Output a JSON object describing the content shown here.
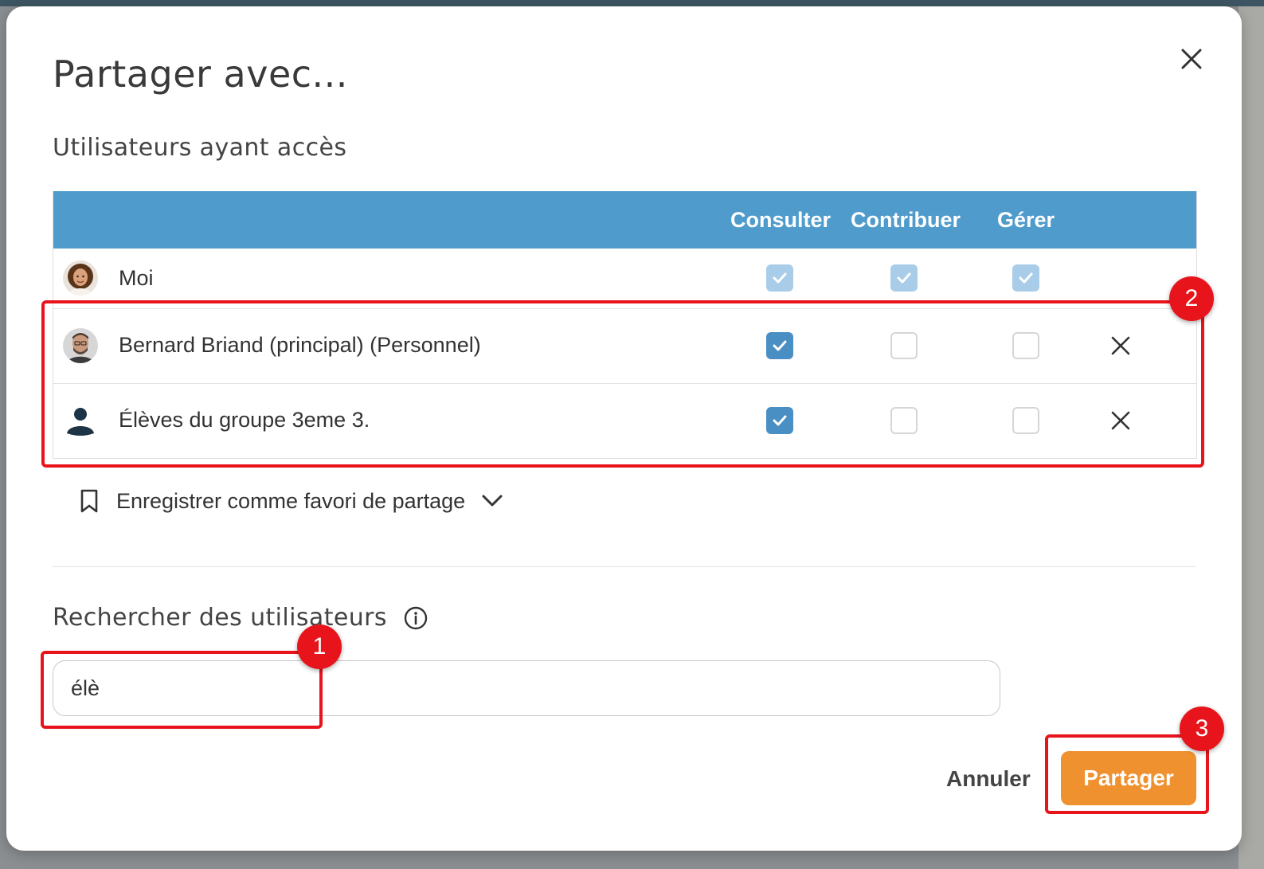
{
  "dialog": {
    "title": "Partager avec...",
    "access_section_title": "Utilisateurs ayant accès",
    "columns": [
      "Consulter",
      "Contribuer",
      "Gérer"
    ],
    "users": [
      {
        "name": "Moi",
        "avatar": "woman-photo",
        "consulter": "checked-disabled",
        "contribuer": "checked-disabled",
        "gerer": "checked-disabled",
        "removable": false
      },
      {
        "name": "Bernard Briand (principal) (Personnel)",
        "avatar": "man-photo",
        "consulter": "checked",
        "contribuer": "unchecked",
        "gerer": "unchecked",
        "removable": true
      },
      {
        "name": "Élèves du groupe 3eme 3.",
        "avatar": "group-person-icon",
        "consulter": "checked",
        "contribuer": "unchecked",
        "gerer": "unchecked",
        "removable": true
      }
    ],
    "favorite_label": "Enregistrer comme favori de partage",
    "search_section_title": "Rechercher des utilisateurs",
    "search_value": "élè",
    "cancel_label": "Annuler",
    "share_label": "Partager"
  },
  "annotations": {
    "badge_1": "1",
    "badge_2": "2",
    "badge_3": "3"
  },
  "colors": {
    "header_blue": "#4f9bcb",
    "checkbox_blue": "#4a8fc4",
    "share_orange": "#f0912f",
    "callout_red": "#e8141c"
  }
}
